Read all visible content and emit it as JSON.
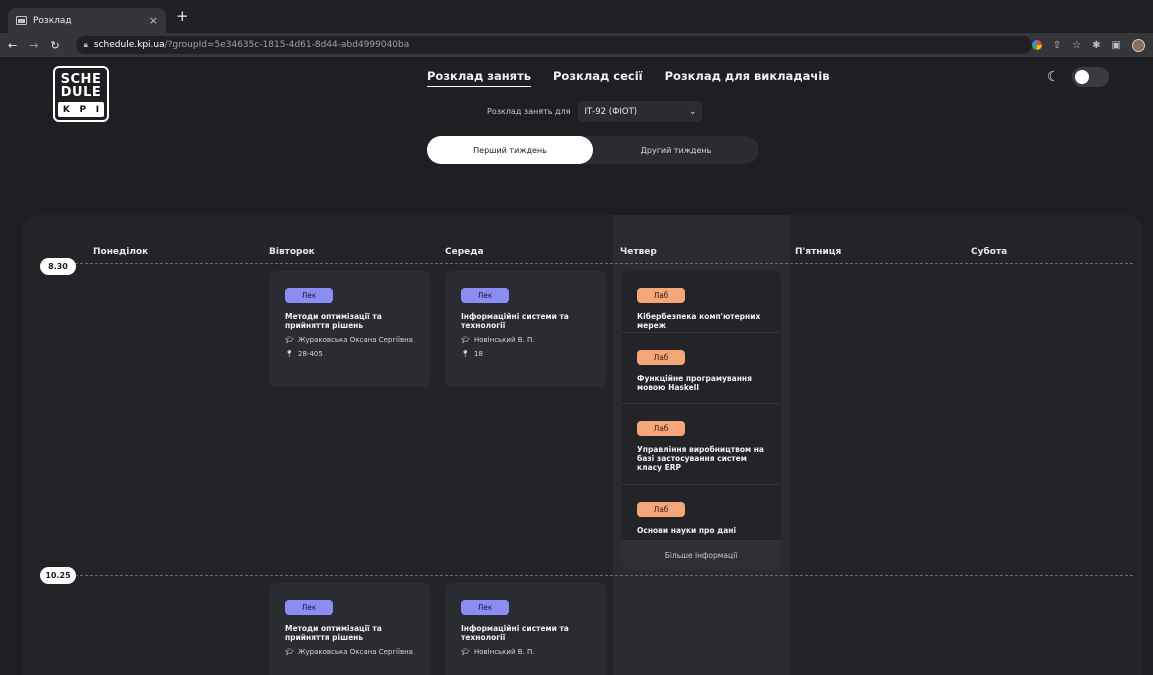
{
  "browser": {
    "tab_title": "Розклад",
    "tab_close": "×",
    "new_tab": "+",
    "url_host": "schedule.kpi.ua",
    "url_path": "/?groupId=5e34635c-1815-4d61-8d44-abd4999040ba"
  },
  "logo": {
    "line1": "SCHE",
    "line2": "DULE",
    "letters": [
      "K",
      "P",
      "I"
    ]
  },
  "nav": {
    "items": [
      {
        "label": "Розклад занять",
        "active": true
      },
      {
        "label": "Розклад сесії",
        "active": false
      },
      {
        "label": "Розклад для викладачів",
        "active": false
      }
    ]
  },
  "group": {
    "label": "Розклад занять для",
    "value": "ІТ-92 (ФІОТ)"
  },
  "weeks": {
    "first": "Перший тиждень",
    "second": "Другий тиждень"
  },
  "days": [
    "Понеділок",
    "Вівторок",
    "Середа",
    "Четвер",
    "П'ятниця",
    "Субота"
  ],
  "times": [
    "8.30",
    "10.25"
  ],
  "slot1": {
    "tuesday": {
      "type": "Лек",
      "title": "Методи оптимізації та прийняття рішень",
      "teacher": "Жураковська Оксана Сергіївна",
      "room": "28-405"
    },
    "wednesday": {
      "type": "Лек",
      "title": "Інформаційні системи та технології",
      "teacher": "Новінський В. П.",
      "room": "18"
    },
    "thursday": {
      "items": [
        {
          "type": "Лаб",
          "title": "Кібербезпека комп'ютерних мереж"
        },
        {
          "type": "Лаб",
          "title": "Функційне програмування мовою Haskell"
        },
        {
          "type": "Лаб",
          "title": "Управління виробництвом на базі застосування систем класу ERP"
        },
        {
          "type": "Лаб",
          "title": "Основи науки про дані"
        }
      ],
      "more": "Більше інформації"
    }
  },
  "slot2": {
    "tuesday": {
      "type": "Лек",
      "title": "Методи оптимізації та прийняття рішень",
      "teacher": "Жураковська Оксана Сергіївна"
    },
    "wednesday": {
      "type": "Лек",
      "title": "Інформаційні системи та технології",
      "teacher": "Новінський В. П."
    }
  },
  "colors": {
    "lecture": "#8b8cf4",
    "lab": "#f5a77a",
    "background": "#1d1e22"
  }
}
